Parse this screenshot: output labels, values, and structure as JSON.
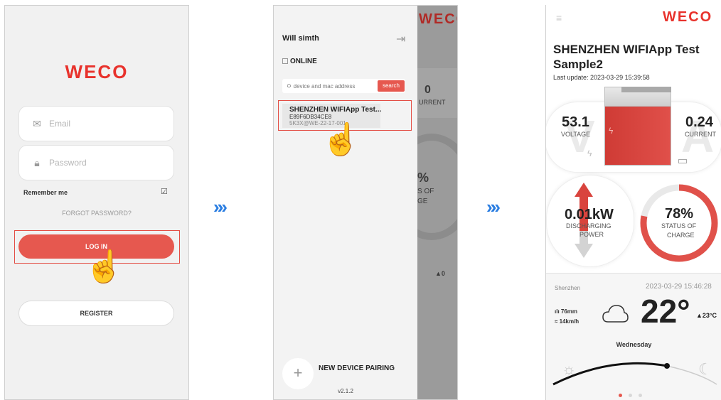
{
  "brand": {
    "logo_text": "WECO",
    "accent_color": "#e6584f",
    "arrow_color": "#2a7de1"
  },
  "screen1": {
    "email_placeholder": "Email",
    "password_placeholder": "Password",
    "remember_label": "Remember me",
    "remember_checked": true,
    "forgot_label": "FORGOT PASSWORD?",
    "login_label": "LOG IN",
    "register_label": "REGISTER"
  },
  "flow_arrow": "»",
  "screen2": {
    "user_name": "Will simth",
    "online_label": "ONLINE",
    "search_placeholder": "device and mac address",
    "search_button": "search",
    "device": {
      "name": "SHENZHEN WIFIApp Test...",
      "mac": "E89F6DB34CE8",
      "serial": "5K3X@WE-22-17-001"
    },
    "pair_label": "NEW DEVICE PAIRING",
    "version": "v2.1.2",
    "background_values": {
      "current_value": "0",
      "current_label": "URRENT",
      "percent_value": "%",
      "percent_label_1": "S OF",
      "percent_label_2": "GE",
      "temp_value": "▲0"
    }
  },
  "screen3": {
    "device_title": "SHENZHEN WIFIApp Test Sample2",
    "last_update": "Last update:  2023-03-29 15:39:58",
    "voltage_value": "53.1",
    "voltage_label": "VOLTAGE",
    "current_value": "0.24",
    "current_label": "CURRENT",
    "power_value": "0.01kW",
    "power_label_1": "DISCHARGING",
    "power_label_2": "POWER",
    "charge_value": "78%",
    "charge_percent": 78,
    "charge_label_1": "STATUS OF",
    "charge_label_2": "CHARGE",
    "city": "Shenzhen",
    "weather_time": "2023-03-29 15:46:28",
    "rain": "76mm",
    "wind": "14km/h",
    "temp": "22°",
    "temp_small": "▲23°C",
    "weekday": "Wednesday"
  }
}
